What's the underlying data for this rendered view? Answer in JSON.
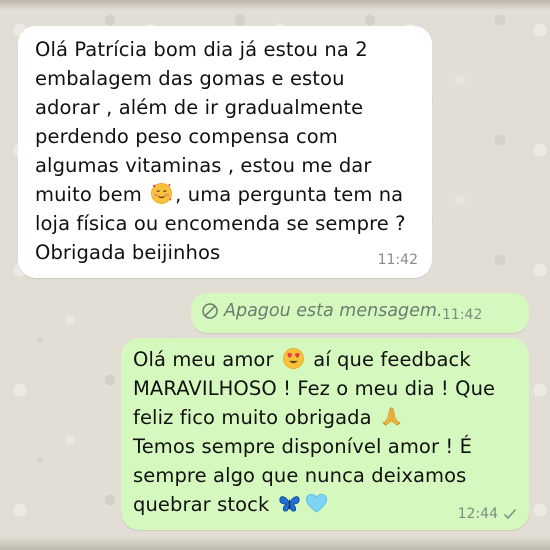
{
  "conversation": {
    "incoming": {
      "lines": [
        "Olá Patrícia bom dia já estou na 2",
        "embalagem das gomas e estou",
        "adorar , além de ir gradualmente",
        "perdendo peso compensa com",
        "algumas vitaminas , estou me dar",
        "muito bem",
        ", uma pergunta tem na",
        "loja física ou encomenda se sempre ?",
        "Obrigada beijinhos"
      ],
      "emoji": "smiling-face-with-hearts",
      "time": "11:42"
    },
    "deleted": {
      "text": "Apagou esta mensagem.",
      "time": "11:42"
    },
    "outgoing": {
      "lines": [
        "Olá meu amor",
        "aí que feedback",
        "MARAVILHOSO ! Fez o meu dia ! Que",
        "feliz fico muito obrigada",
        "Temos sempre disponível amor ! É",
        "sempre algo que nunca deixamos",
        "quebrar stock"
      ],
      "emojis": [
        "heart-eyes",
        "folded-hands",
        "blue-butterfly",
        "light-blue-heart"
      ],
      "time": "12:44",
      "status": "sent-check"
    }
  },
  "colors": {
    "wallpaper": "#e3ded5",
    "incoming_bubble": "#ffffff",
    "outgoing_bubble": "#d5f8bf",
    "timestamp": "#7d8b7f"
  }
}
